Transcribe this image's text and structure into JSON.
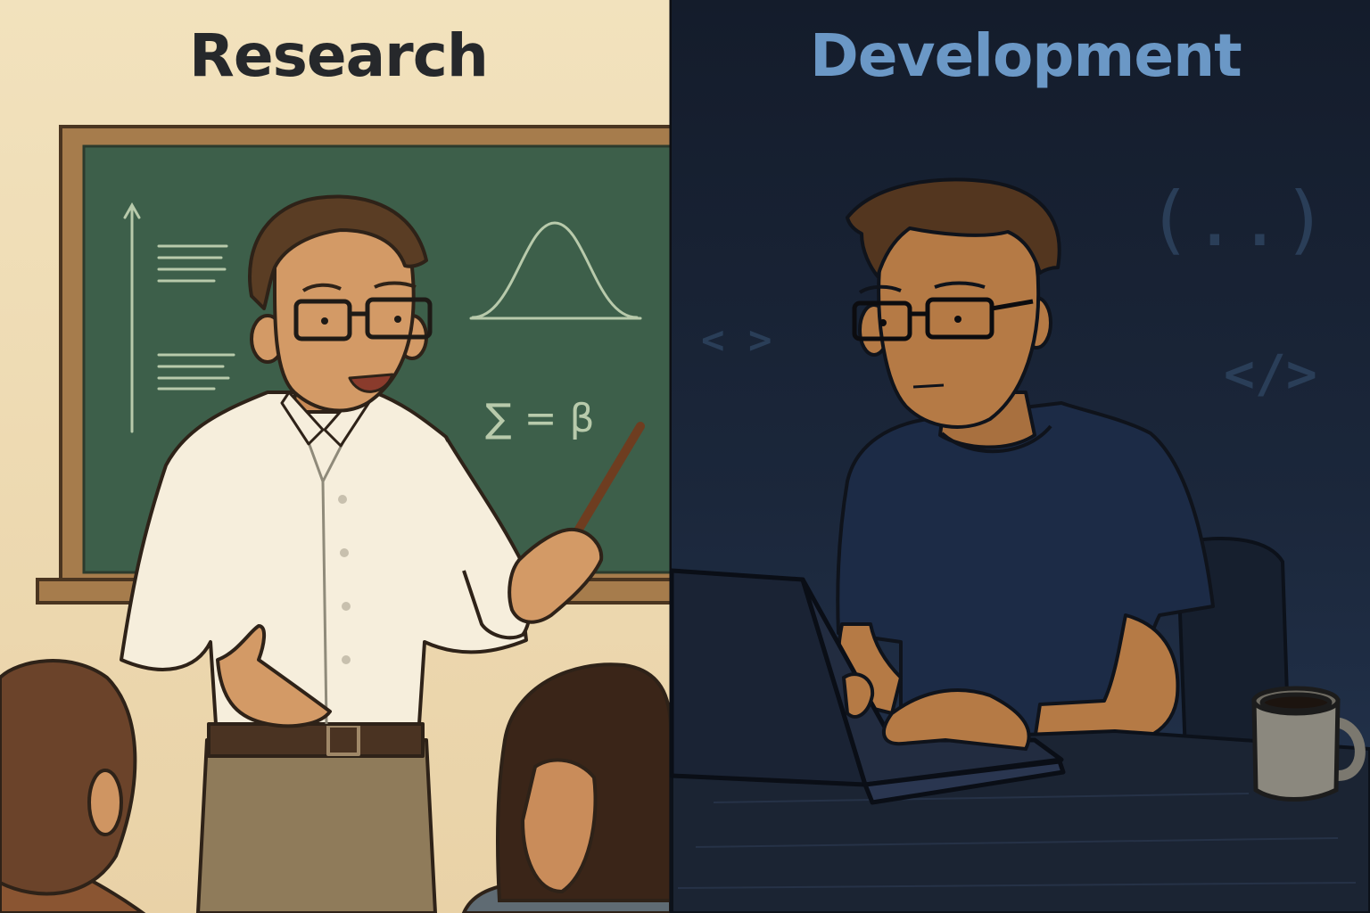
{
  "panels": {
    "research": {
      "title": "Research",
      "background": "#efdcb4",
      "chalkboard": {
        "equation": "∑ = β"
      }
    },
    "development": {
      "title": "Development",
      "background": "#1a2538",
      "code_symbols": {
        "angle": "< >",
        "closing_tag": "</>",
        "parens": "(..)"
      }
    }
  },
  "colors": {
    "chalkboard": "#3c5e49",
    "board_frame": "#a47b4b",
    "chalk": "#b7c9a9",
    "dev_title": "#6b98c6",
    "shirt_white": "#f6eedc",
    "tshirt_navy": "#1c2b46",
    "skin": "#d19865",
    "hair": "#5b3e24"
  },
  "icons": [
    "pointer-stick",
    "glasses",
    "laptop",
    "coffee-mug",
    "bell-curve",
    "axis-arrow"
  ]
}
